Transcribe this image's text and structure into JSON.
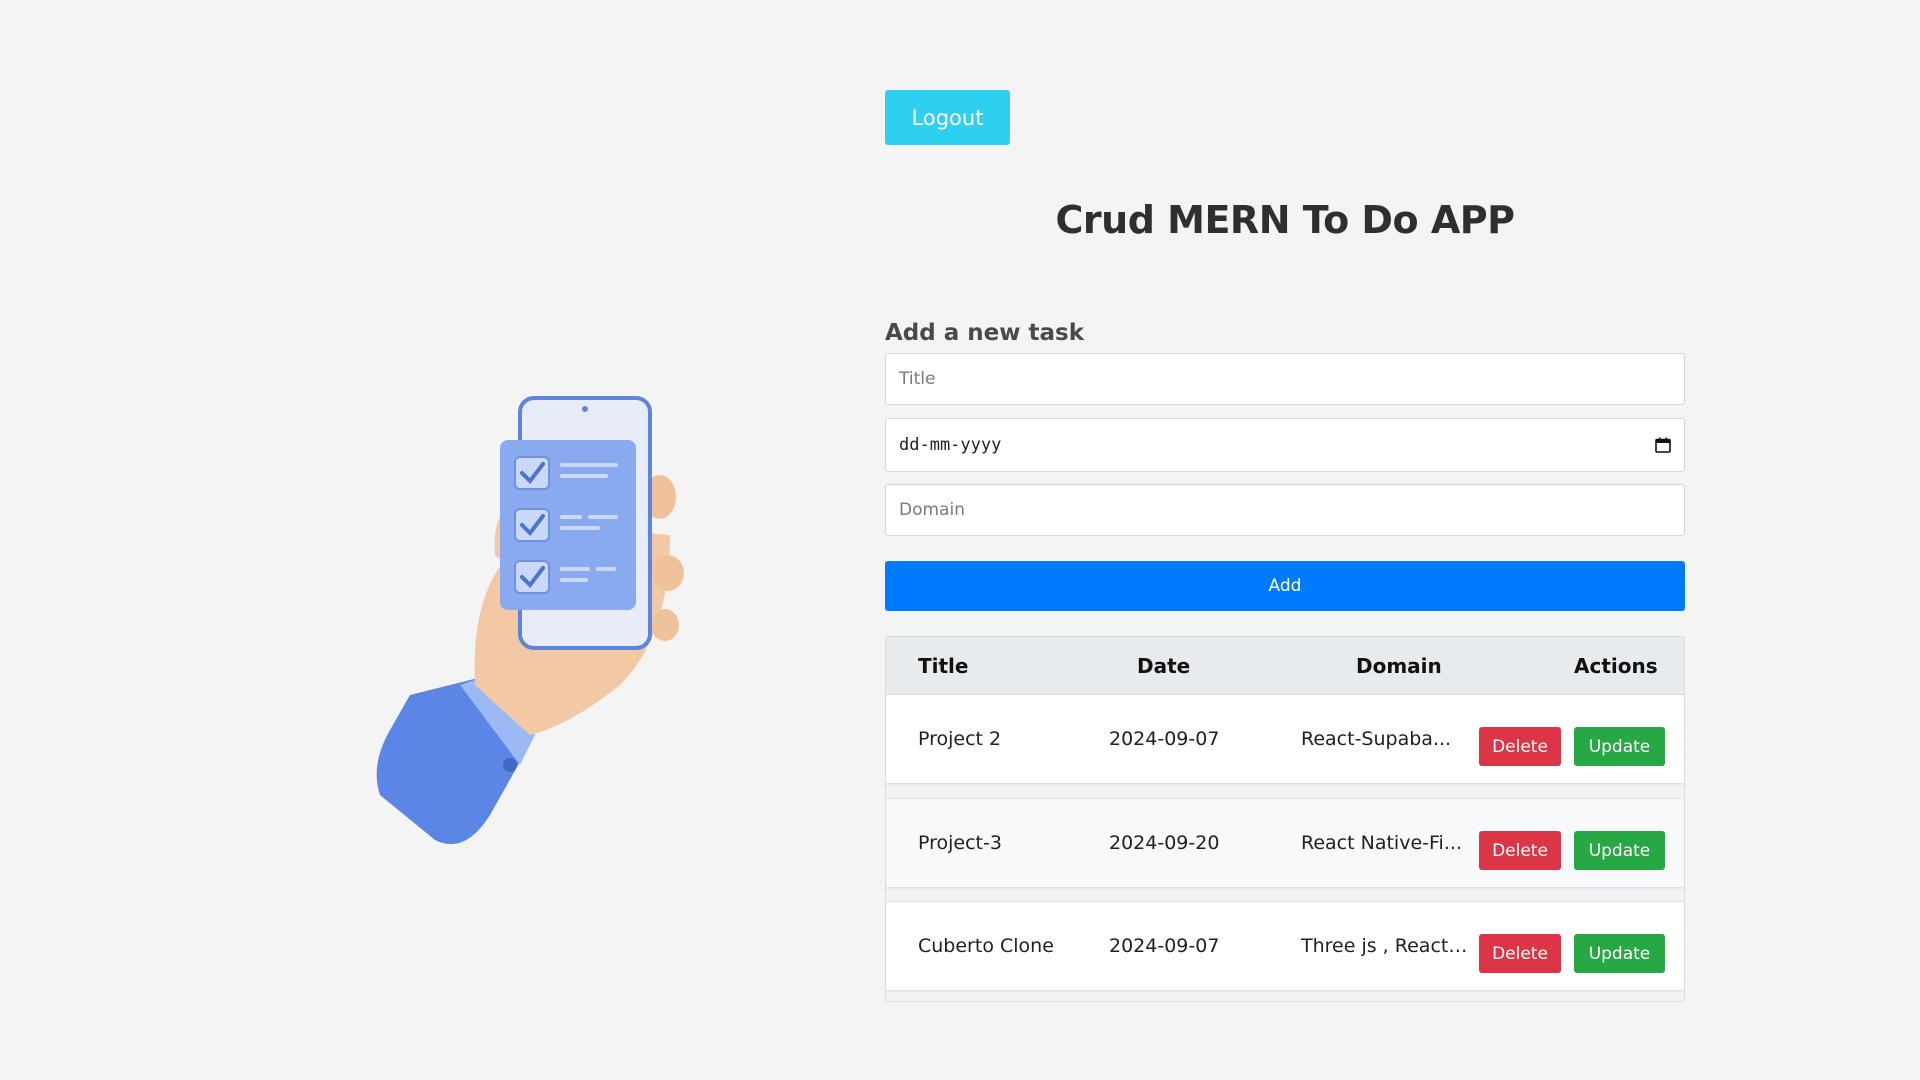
{
  "header": {
    "logout_label": "Logout"
  },
  "page": {
    "title": "Crud MERN To Do APP"
  },
  "form": {
    "heading": "Add a new task",
    "title_placeholder": "Title",
    "date_placeholder": "dd-mm-yyyy",
    "domain_placeholder": "Domain",
    "add_label": "Add"
  },
  "table": {
    "headers": [
      "Title",
      "Date",
      "Domain",
      "Actions"
    ],
    "rows": [
      {
        "title": "Project 2",
        "date": "2024-09-07",
        "domain": "React-Supaba...",
        "delete_label": "Delete",
        "update_label": "Update"
      },
      {
        "title": "Project-3",
        "date": "2024-09-20",
        "domain": "React Native-Fi...",
        "delete_label": "Delete",
        "update_label": "Update"
      },
      {
        "title": "Cuberto Clone",
        "date": "2024-09-07",
        "domain": "Three js , React ...",
        "delete_label": "Delete",
        "update_label": "Update"
      }
    ]
  },
  "icons": {
    "illustration": "hand-holding-phone-checklist-illustration",
    "calendar": "calendar-icon"
  },
  "colors": {
    "logout": "#2dd1ef",
    "add": "#007bff",
    "delete": "#dc3545",
    "update": "#28a745"
  }
}
